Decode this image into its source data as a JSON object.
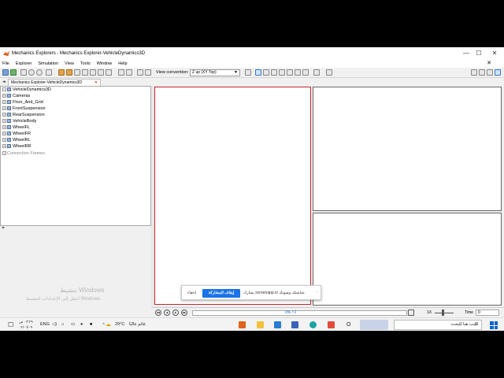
{
  "window": {
    "title": "Mechanics Explorers - Mechanics Explorer-VehicleDynamics3D",
    "controls": [
      "—",
      "☐",
      "✕"
    ]
  },
  "menu": {
    "items": [
      "File",
      "Explorer",
      "Simulation",
      "View",
      "Tools",
      "Window",
      "Help"
    ],
    "close": "✕"
  },
  "toolbar": {
    "view_convention_label": "View convention:",
    "view_convention_value": "Z up (XY Top)"
  },
  "tabs": [
    {
      "label": "Mechanics Explorer-VehicleDynamics3D",
      "close": "✕"
    }
  ],
  "tree": {
    "root": "VehicleDynamics3D",
    "items": [
      {
        "label": "Cameras"
      },
      {
        "label": "Floor_And_Grid"
      },
      {
        "label": "FrontSuspension"
      },
      {
        "label": "RearSuspension"
      },
      {
        "label": "VehicleBody"
      },
      {
        "label": "WheelFL"
      },
      {
        "label": "WheelFR"
      },
      {
        "label": "WheelRL"
      },
      {
        "label": "WheelRR"
      }
    ],
    "connection_frames": "Connection Frames"
  },
  "watermark": {
    "line1": "تنشيط Windows",
    "line2": "انتقل إلى الإعدادات لتنشيط Windows."
  },
  "share_bar": {
    "dismiss": "إخفاء",
    "stop": "إيقاف المشاركة",
    "message": "يشارك screenapp.io شاشتك وصوتك."
  },
  "playback": {
    "progress": "0% / 0",
    "speed": "1X",
    "time_label": "Time",
    "time_value": "0"
  },
  "taskbar": {
    "search_placeholder": "اكتب هنا للبحث",
    "weather_temp": "29°C",
    "weather_text": "غائم غالبًا",
    "language": "ENG",
    "time": "٠٣:٢٩ ص",
    "date": "٠٢/٠٦/٠٩"
  }
}
